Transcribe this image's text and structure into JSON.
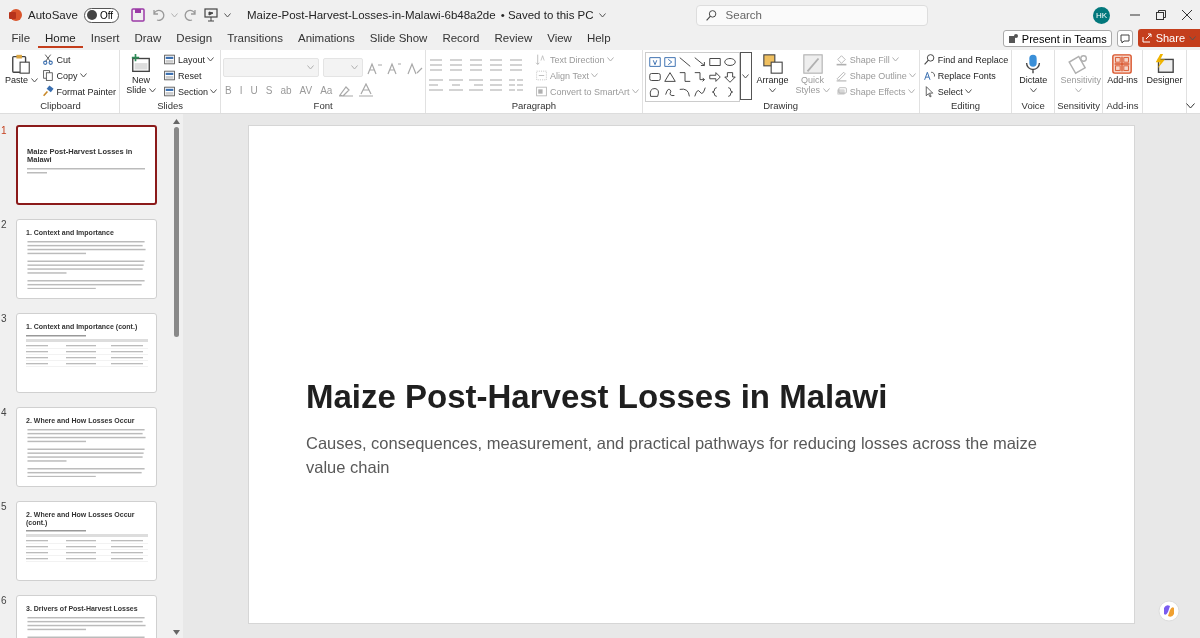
{
  "titlebar": {
    "autosave_label": "AutoSave",
    "autosave": {
      "on": false,
      "label": "Off"
    },
    "doc_title": "Maize-Post-Harvest-Losses-in-Malawi-6b48a2de",
    "save_status": "• Saved to this PC",
    "search": {
      "placeholder": "Search"
    },
    "avatar": "HK"
  },
  "tabs": [
    {
      "label": "File",
      "selected": false
    },
    {
      "label": "Home",
      "selected": true
    },
    {
      "label": "Insert",
      "selected": false
    },
    {
      "label": "Draw",
      "selected": false
    },
    {
      "label": "Design",
      "selected": false
    },
    {
      "label": "Transitions",
      "selected": false
    },
    {
      "label": "Animations",
      "selected": false
    },
    {
      "label": "Slide Show",
      "selected": false
    },
    {
      "label": "Record",
      "selected": false
    },
    {
      "label": "Review",
      "selected": false
    },
    {
      "label": "View",
      "selected": false
    },
    {
      "label": "Help",
      "selected": false
    }
  ],
  "actions": {
    "present": "Present in Teams",
    "share": "Share"
  },
  "ribbon": [
    {
      "kind": "buttons",
      "label": "Clipboard",
      "items": [
        {
          "label": "Paste",
          "kind": "large",
          "menu": true,
          "disabled": false
        },
        {
          "label": "Cut",
          "kind": "small",
          "menu": false,
          "disabled": false
        },
        {
          "label": "Copy",
          "kind": "small",
          "menu": true,
          "disabled": false
        },
        {
          "label": "Format Painter",
          "kind": "small",
          "menu": false,
          "disabled": false
        }
      ]
    },
    {
      "kind": "buttons",
      "label": "Slides",
      "items": [
        {
          "label": "New Slide",
          "kind": "large",
          "menu": true,
          "disabled": false
        },
        {
          "label": "Layout",
          "kind": "small",
          "menu": true,
          "disabled": false
        },
        {
          "label": "Reset",
          "kind": "small",
          "menu": false,
          "disabled": false
        },
        {
          "label": "Section",
          "kind": "small",
          "menu": true,
          "disabled": false
        }
      ]
    },
    {
      "kind": "font",
      "label": "Font",
      "glyphs": [
        "B",
        "I",
        "U",
        "S",
        "ab",
        "AV",
        "Aa"
      ]
    },
    {
      "kind": "paragraph",
      "label": "Paragraph",
      "items": [
        {
          "label": "Text Direction",
          "kind": "small",
          "menu": true,
          "disabled": true
        },
        {
          "label": "Align Text",
          "kind": "small",
          "menu": true,
          "disabled": true
        },
        {
          "label": "Convert to SmartArt",
          "kind": "small",
          "menu": true,
          "disabled": true
        }
      ]
    },
    {
      "kind": "drawing",
      "label": "Drawing",
      "items": [
        {
          "label": "Arrange",
          "kind": "large",
          "menu": true,
          "disabled": false
        },
        {
          "label": "Quick Styles",
          "kind": "large",
          "menu": true,
          "disabled": true
        },
        {
          "label": "Shape Fill",
          "kind": "small",
          "menu": true,
          "disabled": true
        },
        {
          "label": "Shape Outline",
          "kind": "small",
          "menu": true,
          "disabled": true
        },
        {
          "label": "Shape Effects",
          "kind": "small",
          "menu": true,
          "disabled": true
        }
      ]
    },
    {
      "kind": "buttons",
      "label": "Editing",
      "items": [
        {
          "label": "Find and Replace",
          "kind": "small",
          "menu": false,
          "disabled": false
        },
        {
          "label": "Replace Fonts",
          "kind": "small",
          "menu": false,
          "disabled": false
        },
        {
          "label": "Select",
          "kind": "small",
          "menu": true,
          "disabled": false
        }
      ]
    },
    {
      "kind": "buttons",
      "label": "Voice",
      "items": [
        {
          "label": "Dictate",
          "kind": "large",
          "menu": true,
          "disabled": false
        }
      ]
    },
    {
      "kind": "buttons",
      "label": "Sensitivity",
      "items": [
        {
          "label": "Sensitivity",
          "kind": "large",
          "menu": true,
          "disabled": true
        }
      ]
    },
    {
      "kind": "buttons",
      "label": "Add-ins",
      "items": [
        {
          "label": "Add-ins",
          "kind": "large",
          "menu": false,
          "disabled": false
        }
      ]
    },
    {
      "kind": "buttons",
      "items": [
        {
          "label": "Designer",
          "kind": "large",
          "menu": false,
          "disabled": false
        }
      ]
    }
  ],
  "slides": [
    {
      "number": "1",
      "kind": "title",
      "title": "Maize Post-Harvest Losses in Malawi",
      "selected": true
    },
    {
      "number": "2",
      "kind": "text",
      "title": "1. Context and Importance",
      "selected": false
    },
    {
      "number": "3",
      "kind": "table",
      "title": "1. Context and Importance (cont.)",
      "selected": false
    },
    {
      "number": "4",
      "kind": "text",
      "title": "2. Where and How Losses Occur",
      "selected": false
    },
    {
      "number": "5",
      "kind": "table",
      "title": "2. Where and How Losses Occur (cont.)",
      "selected": false
    },
    {
      "number": "6",
      "kind": "text",
      "title": "3. Drivers of Post-Harvest Losses",
      "selected": false
    }
  ],
  "slide": {
    "title": "Maize Post-Harvest Losses in Malawi",
    "subtitle": "Causes, consequences, measurement, and practical pathways for reducing losses across the maize value chain"
  }
}
